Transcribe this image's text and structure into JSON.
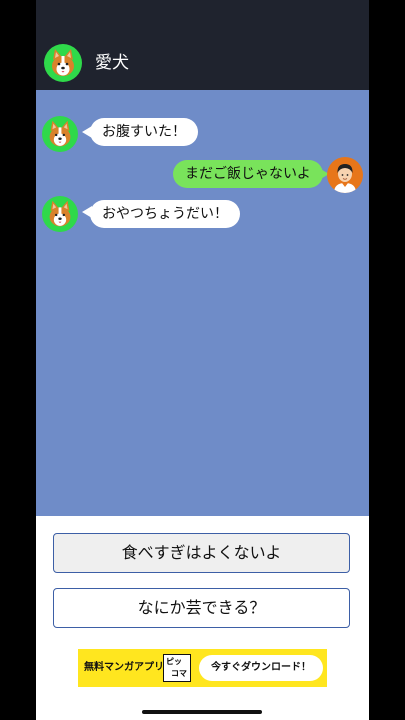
{
  "header": {
    "title": "愛犬",
    "avatar_icon": "corgi-avatar-icon"
  },
  "messages": [
    {
      "sender": "dog",
      "text": "お腹すいた！"
    },
    {
      "sender": "user",
      "text": "まだご飯じゃないよ"
    },
    {
      "sender": "dog",
      "text": "おやつちょうだい！"
    }
  ],
  "choices": [
    {
      "label": "食べすぎはよくないよ"
    },
    {
      "label": "なにか芸できる？"
    }
  ],
  "ad": {
    "left_text": "無料マンガアプリ",
    "logo_top": "ピッ",
    "logo_bottom": "コマ",
    "cta": "今すぐダウンロード！"
  },
  "colors": {
    "header_bg": "#1f232e",
    "chat_bg": "#6f8cc8",
    "dog_avatar_bg": "#2fd94a",
    "user_avatar_bg": "#e7761a",
    "outgoing_bubble": "#79e35b",
    "choice_border": "#3d5fa6",
    "ad_bg": "#ffe61f"
  }
}
